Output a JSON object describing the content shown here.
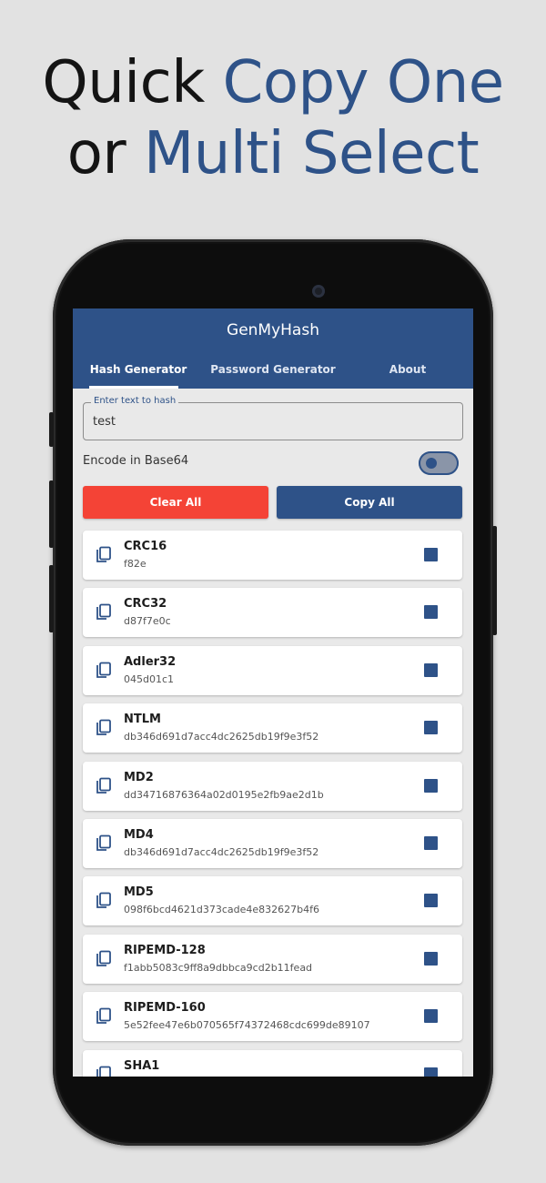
{
  "headline": {
    "line1_plain": "Quick ",
    "line1_accent": "Copy One",
    "line2_plain": "or ",
    "line2_accent": "Multi Select"
  },
  "app": {
    "title": "GenMyHash",
    "tabs": [
      {
        "label": "Hash Generator",
        "active": true
      },
      {
        "label": "Password Generator",
        "active": false
      },
      {
        "label": "About",
        "active": false
      }
    ]
  },
  "input": {
    "label": "Enter text to hash",
    "value": "test"
  },
  "encode": {
    "label": "Encode in Base64",
    "enabled": false
  },
  "actions": {
    "clear_label": "Clear All",
    "copy_label": "Copy All"
  },
  "hashes": [
    {
      "name": "CRC16",
      "value": "f82e"
    },
    {
      "name": "CRC32",
      "value": "d87f7e0c"
    },
    {
      "name": "Adler32",
      "value": "045d01c1"
    },
    {
      "name": "NTLM",
      "value": "db346d691d7acc4dc2625db19f9e3f52"
    },
    {
      "name": "MD2",
      "value": "dd34716876364a02d0195e2fb9ae2d1b"
    },
    {
      "name": "MD4",
      "value": "db346d691d7acc4dc2625db19f9e3f52"
    },
    {
      "name": "MD5",
      "value": "098f6bcd4621d373cade4e832627b4f6"
    },
    {
      "name": "RIPEMD-128",
      "value": "f1abb5083c9ff8a9dbbca9cd2b11fead"
    },
    {
      "name": "RIPEMD-160",
      "value": "5e52fee47e6b070565f74372468cdc699de89107"
    },
    {
      "name": "SHA1",
      "value": ""
    }
  ],
  "colors": {
    "primary": "#2e5288",
    "danger": "#f44336",
    "background": "#e2e2e2"
  }
}
